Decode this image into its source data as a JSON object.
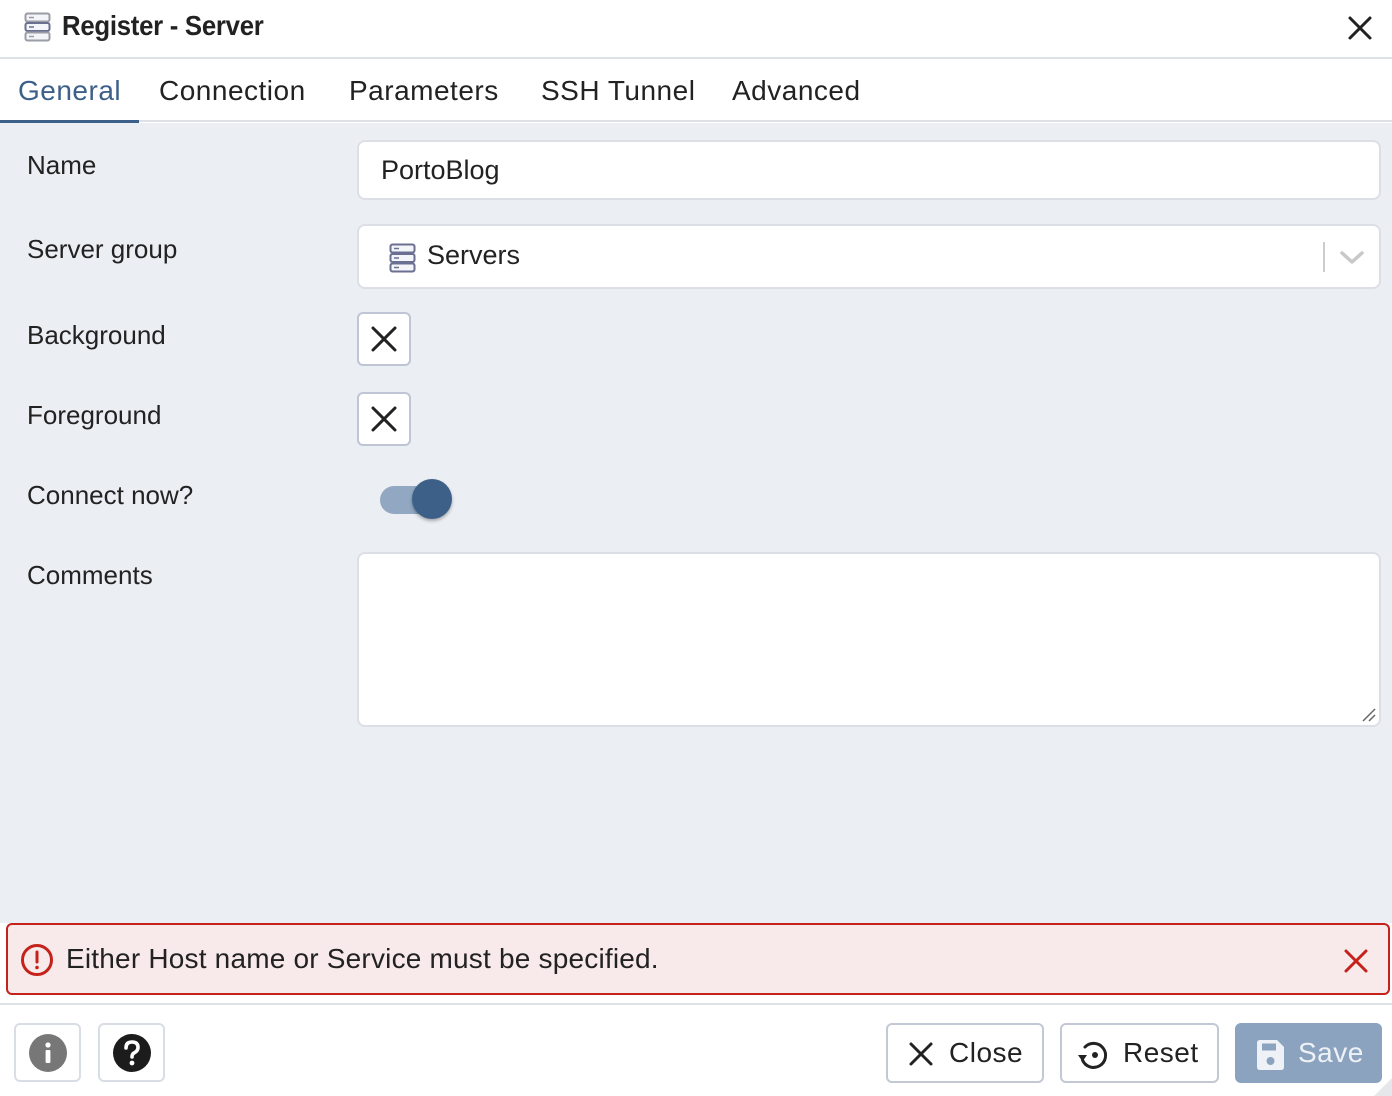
{
  "window": {
    "title": "Register - Server",
    "title_icon": "server-icon",
    "close_icon": "close-icon"
  },
  "tabs": [
    {
      "label": "General",
      "active": true
    },
    {
      "label": "Connection",
      "active": false
    },
    {
      "label": "Parameters",
      "active": false
    },
    {
      "label": "SSH Tunnel",
      "active": false
    },
    {
      "label": "Advanced",
      "active": false
    }
  ],
  "form": {
    "name": {
      "label": "Name",
      "value": "PortoBlog"
    },
    "server_group": {
      "label": "Server group",
      "value": "Servers",
      "icon": "server-group-icon"
    },
    "background": {
      "label": "Background",
      "value": "none",
      "icon": "clear-color-icon"
    },
    "foreground": {
      "label": "Foreground",
      "value": "none",
      "icon": "clear-color-icon"
    },
    "connect_now": {
      "label": "Connect now?",
      "checked": true
    },
    "comments": {
      "label": "Comments",
      "value": ""
    }
  },
  "error": {
    "message": "Either Host name or Service must be specified.",
    "icon": "error-circle-icon"
  },
  "footer": {
    "info_icon": "info-icon",
    "help_icon": "help-icon",
    "close_label": "Close",
    "reset_label": "Reset",
    "save_label": "Save",
    "save_enabled": false
  },
  "colors": {
    "accent": "#3d6089",
    "error": "#c4221a",
    "error_bg": "#f8eaeb",
    "panel_bg": "#ebeef3",
    "save_disabled": "#8ba3be"
  }
}
